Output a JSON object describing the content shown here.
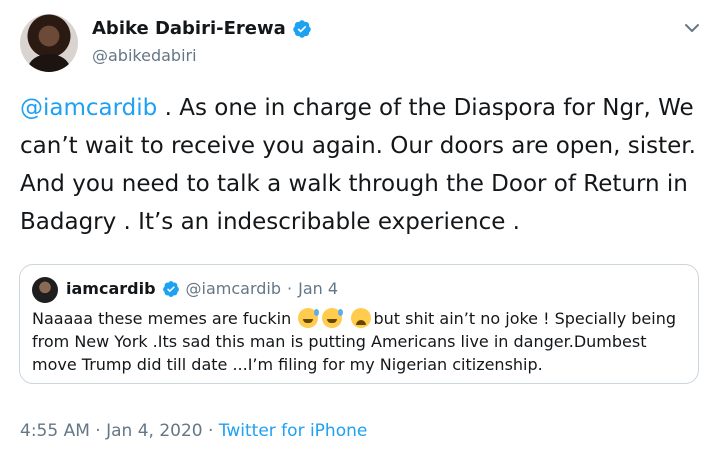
{
  "author": {
    "display_name": "Abike Dabiri-Erewa",
    "handle": "@abikedabiri"
  },
  "tweet": {
    "mention": "@iamcardib",
    "text": " . As one in charge of the Diaspora for Ngr, We can’t wait to receive you again. Our doors are open, sister. And you need to talk a walk through the Door of Return in Badagry . It’s an indescribable experience ."
  },
  "quoted_tweet": {
    "display_name": "iamcardib",
    "handle": "@iamcardib",
    "separator": "·",
    "date": "Jan 4",
    "text_part1": "Naaaaa these memes are fuckin",
    "emojis": [
      "grinning-sweat-emoji",
      "grinning-sweat-emoji",
      "weary-face-emoji"
    ],
    "text_part2": "but shit ain’t no joke ! Specially being from New York .Its sad this man is putting Americans live in danger.Dumbest move Trump did till date ...I’m filing for my Nigerian citizenship."
  },
  "footer": {
    "time_date": "4:55 AM · Jan 4, 2020 · ",
    "source": "Twitter for iPhone"
  },
  "colors": {
    "link": "#1da1f2",
    "secondary_text": "#657786",
    "border": "#ccd6dd"
  }
}
